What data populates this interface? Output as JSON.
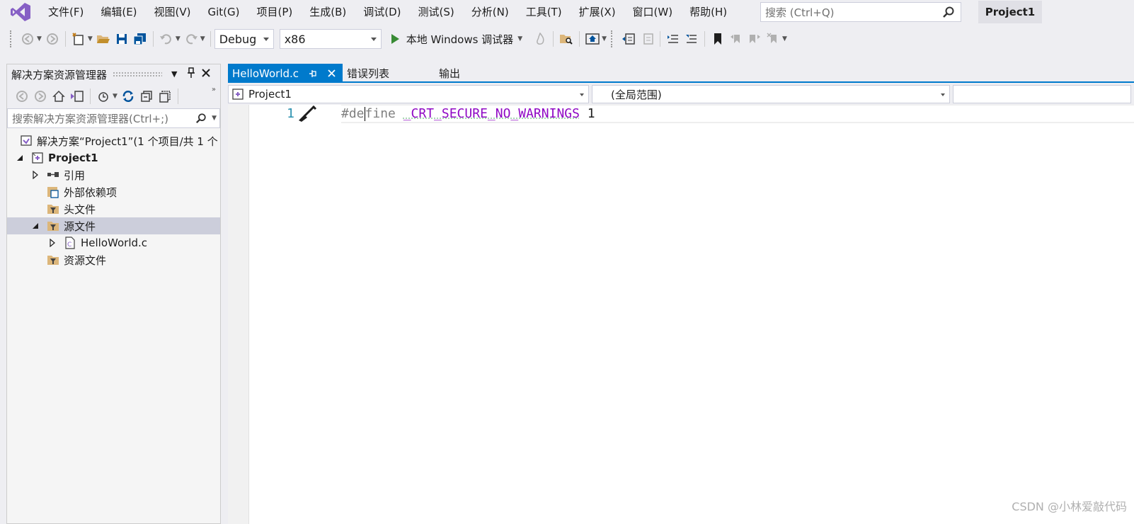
{
  "menubar": {
    "items": [
      "文件(F)",
      "编辑(E)",
      "视图(V)",
      "Git(G)",
      "项目(P)",
      "生成(B)",
      "调试(D)",
      "测试(S)",
      "分析(N)",
      "工具(T)",
      "扩展(X)",
      "窗口(W)",
      "帮助(H)"
    ],
    "search_placeholder": "搜索 (Ctrl+Q)",
    "project_name": "Project1"
  },
  "toolbar": {
    "config": "Debug",
    "platform": "x86",
    "run_label": "本地 Windows 调试器"
  },
  "solution_explorer": {
    "title": "解决方案资源管理器",
    "search_placeholder": "搜索解决方案资源管理器(Ctrl+;)",
    "tree": {
      "solution": "解决方案“Project1”(1 个项目/共 1 个",
      "project": "Project1",
      "references": "引用",
      "external_deps": "外部依赖项",
      "header_files": "头文件",
      "source_files": "源文件",
      "source_file_1": "HelloWorld.c",
      "resource_files": "资源文件"
    }
  },
  "editor": {
    "tabs": {
      "active": "HelloWorld.c",
      "errors": "错误列表",
      "output": "输出"
    },
    "nav": {
      "project": "Project1",
      "scope": "(全局范围)"
    },
    "line_number": "1",
    "code": {
      "directive_a": "#de",
      "directive_b": "fine ",
      "macro": "_CRT_SECURE_NO_WARNINGS",
      "value": " 1"
    }
  },
  "watermark": "CSDN @小林爱敲代码",
  "colors": {
    "accent": "#007acc",
    "macro": "#8f08c4",
    "line_number": "#2b91af",
    "run_green": "#388a34",
    "vs_logo": "#865fc5"
  },
  "icons": [
    "vs-logo-icon",
    "search-icon",
    "back-icon",
    "forward-icon",
    "new-project-icon",
    "open-folder-icon",
    "save-icon",
    "save-all-icon",
    "undo-icon",
    "redo-icon",
    "play-icon",
    "hot-reload-icon",
    "find-in-files-icon",
    "home-icon",
    "bookmark-icon",
    "pin-icon",
    "close-icon",
    "sync-icon",
    "collapse-all-icon",
    "show-all-files-icon",
    "expander-icon",
    "brush-icon"
  ]
}
